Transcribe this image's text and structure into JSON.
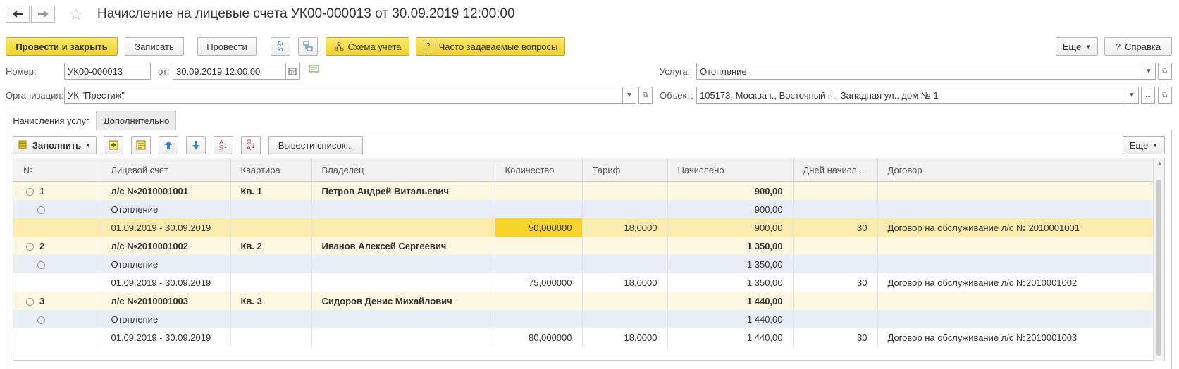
{
  "window": {
    "title": "Начисление на лицевые счета УК00-000013 от 30.09.2019 12:00:00"
  },
  "toolbar": {
    "post_close": "Провести и закрыть",
    "save": "Записать",
    "post": "Провести",
    "dtkt_icon_text": "Дт Кт",
    "scheme": "Схема учета",
    "faq": "Часто задаваемые вопросы",
    "more": "Еще",
    "help": "Справка"
  },
  "form": {
    "number_label": "Номер:",
    "number": "УК00-000013",
    "date_label": "от:",
    "date": "30.09.2019 12:00:00",
    "org_label": "Организация:",
    "org": "УК \"Престиж\"",
    "service_label": "Услуга:",
    "service": "Отопление",
    "object_label": "Объект:",
    "object": "105173, Москва г., Восточный п., Западная ул., дом № 1",
    "dots": "..."
  },
  "tabs": [
    "Начисления услуг",
    "Дополнительно"
  ],
  "table_toolbar": {
    "fill": "Заполнить",
    "output_list": "Вывести список...",
    "more": "Еще"
  },
  "columns": [
    "№",
    "Лицевой счет",
    "Квартира",
    "Владелец",
    "Количество",
    "Тариф",
    "Начислено",
    "Дней начисл...",
    "Договор"
  ],
  "rows": [
    {
      "level": 0,
      "toggle": "⊖",
      "num": "1",
      "account": "л/с №2010001001",
      "flat": "Кв. 1",
      "owner": "Петров Андрей Витальевич",
      "qty": "",
      "tariff": "",
      "amount": "900,00",
      "days": "",
      "contract": ""
    },
    {
      "level": 1,
      "toggle": "⊖",
      "num": "",
      "account": "Отопление",
      "flat": "",
      "owner": "",
      "qty": "",
      "tariff": "",
      "amount": "900,00",
      "days": "",
      "contract": ""
    },
    {
      "level": 2,
      "selected": true,
      "toggle": "",
      "num": "",
      "account": "01.09.2019 - 30.09.2019",
      "flat": "",
      "owner": "",
      "qty": "50,000000",
      "tariff": "18,0000",
      "amount": "900,00",
      "days": "30",
      "contract": "Договор на обслуживание л/с № 2010001001"
    },
    {
      "level": 0,
      "toggle": "⊖",
      "num": "2",
      "account": "л/с №2010001002",
      "flat": "Кв. 2",
      "owner": "Иванов Алексей Сергеевич",
      "qty": "",
      "tariff": "",
      "amount": "1 350,00",
      "days": "",
      "contract": ""
    },
    {
      "level": 1,
      "toggle": "⊖",
      "num": "",
      "account": "Отопление",
      "flat": "",
      "owner": "",
      "qty": "",
      "tariff": "",
      "amount": "1 350,00",
      "days": "",
      "contract": ""
    },
    {
      "level": 2,
      "toggle": "",
      "num": "",
      "account": "01.09.2019 - 30.09.2019",
      "flat": "",
      "owner": "",
      "qty": "75,000000",
      "tariff": "18,0000",
      "amount": "1 350,00",
      "days": "30",
      "contract": "Договор на обслуживание л/с №2010001002"
    },
    {
      "level": 0,
      "toggle": "⊖",
      "num": "3",
      "account": "л/с №2010001003",
      "flat": "Кв. 3",
      "owner": "Сидоров Денис Михайлович",
      "qty": "",
      "tariff": "",
      "amount": "1 440,00",
      "days": "",
      "contract": ""
    },
    {
      "level": 1,
      "toggle": "⊖",
      "num": "",
      "account": "Отопление",
      "flat": "",
      "owner": "",
      "qty": "",
      "tariff": "",
      "amount": "1 440,00",
      "days": "",
      "contract": ""
    },
    {
      "level": 2,
      "toggle": "",
      "num": "",
      "account": "01.09.2019 - 30.09.2019",
      "flat": "",
      "owner": "",
      "qty": "80,000000",
      "tariff": "18,0000",
      "amount": "1 440,00",
      "days": "30",
      "contract": "Договор на обслуживание л/с №2010001003"
    }
  ]
}
